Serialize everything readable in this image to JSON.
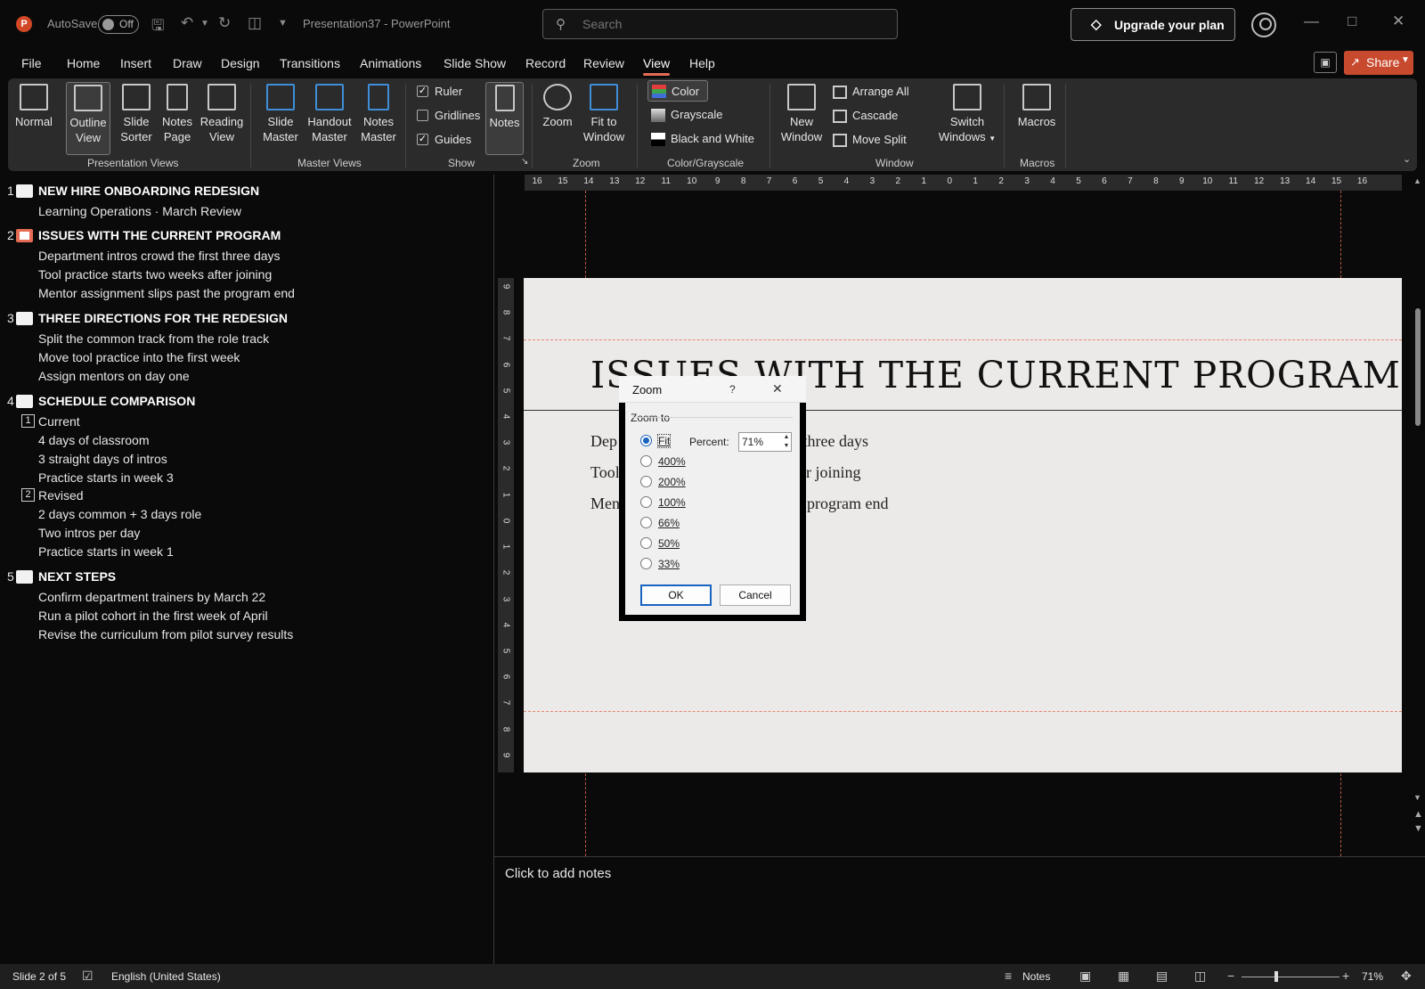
{
  "app": {
    "autosave_label": "AutoSave",
    "autosave_state": "Off",
    "doc_title": "Presentation37  -  PowerPoint",
    "search_placeholder": "Search",
    "upgrade_label": "Upgrade your plan"
  },
  "menu": {
    "tabs": [
      "File",
      "Home",
      "Insert",
      "Draw",
      "Design",
      "Transitions",
      "Animations",
      "Slide Show",
      "Record",
      "Review",
      "View",
      "Help"
    ],
    "active_tab": "View",
    "share_label": "Share"
  },
  "ribbon": {
    "presentation_views": {
      "group_label": "Presentation Views",
      "buttons": [
        {
          "l1": "Normal",
          "l2": ""
        },
        {
          "l1": "Outline",
          "l2": "View"
        },
        {
          "l1": "Slide",
          "l2": "Sorter"
        },
        {
          "l1": "Notes",
          "l2": "Page"
        },
        {
          "l1": "Reading",
          "l2": "View"
        }
      ]
    },
    "master_views": {
      "group_label": "Master Views",
      "buttons": [
        {
          "l1": "Slide",
          "l2": "Master"
        },
        {
          "l1": "Handout",
          "l2": "Master"
        },
        {
          "l1": "Notes",
          "l2": "Master"
        }
      ]
    },
    "show": {
      "group_label": "Show",
      "ruler": "Ruler",
      "gridlines": "Gridlines",
      "guides": "Guides",
      "notes": "Notes"
    },
    "zoom": {
      "group_label": "Zoom",
      "zoom": "Zoom",
      "fit_l1": "Fit to",
      "fit_l2": "Window"
    },
    "color": {
      "group_label": "Color/Grayscale",
      "color": "Color",
      "grayscale": "Grayscale",
      "bw": "Black and White"
    },
    "window": {
      "group_label": "Window",
      "new_l1": "New",
      "new_l2": "Window",
      "arrange_all": "Arrange All",
      "cascade": "Cascade",
      "move_split": "Move Split",
      "switch_l1": "Switch",
      "switch_l2": "Windows"
    },
    "macros": {
      "group_label": "Macros",
      "macros": "Macros"
    }
  },
  "outline": {
    "slides": [
      {
        "num": "1",
        "title": "NEW HIRE ONBOARDING REDESIGN",
        "lines": [
          "Learning Operations · March Review"
        ]
      },
      {
        "num": "2",
        "title": "ISSUES WITH THE CURRENT PROGRAM",
        "lines": [
          "Department intros crowd the first three days",
          "Tool practice starts two weeks after joining",
          "Mentor assignment slips past the program end"
        ]
      },
      {
        "num": "3",
        "title": "THREE DIRECTIONS FOR THE REDESIGN",
        "lines": [
          "Split the common track from the role track",
          "Move tool practice into the first week",
          "Assign mentors on day one"
        ]
      },
      {
        "num": "4",
        "title": "SCHEDULE COMPARISON",
        "sub1_num": "1",
        "sub1": "Current",
        "sub1_lines": [
          "4 days of classroom",
          "3 straight days of intros",
          "Practice starts in week 3"
        ],
        "sub2_num": "2",
        "sub2": "Revised",
        "sub2_lines": [
          "2 days common + 3 days role",
          "Two intros per day",
          "Practice starts in week 1"
        ]
      },
      {
        "num": "5",
        "title": "NEXT STEPS",
        "lines": [
          "Confirm department trainers by March 22",
          "Run a pilot cohort in the first week of April",
          "Revise the curriculum from pilot survey results"
        ]
      }
    ]
  },
  "ruler": {
    "h_ticks": [
      "16",
      "15",
      "14",
      "13",
      "12",
      "11",
      "10",
      "9",
      "8",
      "7",
      "6",
      "5",
      "4",
      "3",
      "2",
      "1",
      "0",
      "1",
      "2",
      "3",
      "4",
      "5",
      "6",
      "7",
      "8",
      "9",
      "10",
      "11",
      "12",
      "13",
      "14",
      "15",
      "16"
    ],
    "v_ticks": [
      "9",
      "8",
      "7",
      "6",
      "5",
      "4",
      "3",
      "2",
      "1",
      "0",
      "1",
      "2",
      "3",
      "4",
      "5",
      "6",
      "7",
      "8",
      "9"
    ]
  },
  "slide": {
    "title": "ISSUES WITH THE CURRENT PROGRAM",
    "body_visible": [
      "Dep",
      "t three days",
      "Tool",
      "er joining",
      "Men",
      "program end"
    ]
  },
  "dialog": {
    "title": "Zoom",
    "help": "?",
    "group": "Zoom to",
    "percent_label": "Percent:",
    "percent_value": "71%",
    "options": [
      "Fit",
      "400%",
      "200%",
      "100%",
      "66%",
      "50%",
      "33%"
    ],
    "selected": "Fit",
    "ok": "OK",
    "cancel": "Cancel"
  },
  "notes": {
    "placeholder": "Click to add notes"
  },
  "status": {
    "slide_info": "Slide 2 of 5",
    "language": "English (United States)",
    "notes": "Notes",
    "zoom": "71%"
  }
}
